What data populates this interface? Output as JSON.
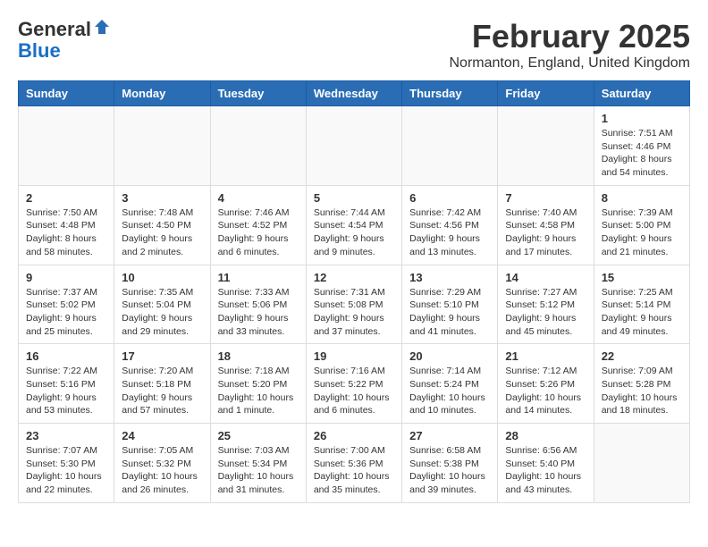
{
  "header": {
    "logo_line1": "General",
    "logo_line2": "Blue",
    "month_title": "February 2025",
    "location": "Normanton, England, United Kingdom"
  },
  "weekdays": [
    "Sunday",
    "Monday",
    "Tuesday",
    "Wednesday",
    "Thursday",
    "Friday",
    "Saturday"
  ],
  "weeks": [
    [
      {
        "day": "",
        "info": ""
      },
      {
        "day": "",
        "info": ""
      },
      {
        "day": "",
        "info": ""
      },
      {
        "day": "",
        "info": ""
      },
      {
        "day": "",
        "info": ""
      },
      {
        "day": "",
        "info": ""
      },
      {
        "day": "1",
        "info": "Sunrise: 7:51 AM\nSunset: 4:46 PM\nDaylight: 8 hours and 54 minutes."
      }
    ],
    [
      {
        "day": "2",
        "info": "Sunrise: 7:50 AM\nSunset: 4:48 PM\nDaylight: 8 hours and 58 minutes."
      },
      {
        "day": "3",
        "info": "Sunrise: 7:48 AM\nSunset: 4:50 PM\nDaylight: 9 hours and 2 minutes."
      },
      {
        "day": "4",
        "info": "Sunrise: 7:46 AM\nSunset: 4:52 PM\nDaylight: 9 hours and 6 minutes."
      },
      {
        "day": "5",
        "info": "Sunrise: 7:44 AM\nSunset: 4:54 PM\nDaylight: 9 hours and 9 minutes."
      },
      {
        "day": "6",
        "info": "Sunrise: 7:42 AM\nSunset: 4:56 PM\nDaylight: 9 hours and 13 minutes."
      },
      {
        "day": "7",
        "info": "Sunrise: 7:40 AM\nSunset: 4:58 PM\nDaylight: 9 hours and 17 minutes."
      },
      {
        "day": "8",
        "info": "Sunrise: 7:39 AM\nSunset: 5:00 PM\nDaylight: 9 hours and 21 minutes."
      }
    ],
    [
      {
        "day": "9",
        "info": "Sunrise: 7:37 AM\nSunset: 5:02 PM\nDaylight: 9 hours and 25 minutes."
      },
      {
        "day": "10",
        "info": "Sunrise: 7:35 AM\nSunset: 5:04 PM\nDaylight: 9 hours and 29 minutes."
      },
      {
        "day": "11",
        "info": "Sunrise: 7:33 AM\nSunset: 5:06 PM\nDaylight: 9 hours and 33 minutes."
      },
      {
        "day": "12",
        "info": "Sunrise: 7:31 AM\nSunset: 5:08 PM\nDaylight: 9 hours and 37 minutes."
      },
      {
        "day": "13",
        "info": "Sunrise: 7:29 AM\nSunset: 5:10 PM\nDaylight: 9 hours and 41 minutes."
      },
      {
        "day": "14",
        "info": "Sunrise: 7:27 AM\nSunset: 5:12 PM\nDaylight: 9 hours and 45 minutes."
      },
      {
        "day": "15",
        "info": "Sunrise: 7:25 AM\nSunset: 5:14 PM\nDaylight: 9 hours and 49 minutes."
      }
    ],
    [
      {
        "day": "16",
        "info": "Sunrise: 7:22 AM\nSunset: 5:16 PM\nDaylight: 9 hours and 53 minutes."
      },
      {
        "day": "17",
        "info": "Sunrise: 7:20 AM\nSunset: 5:18 PM\nDaylight: 9 hours and 57 minutes."
      },
      {
        "day": "18",
        "info": "Sunrise: 7:18 AM\nSunset: 5:20 PM\nDaylight: 10 hours and 1 minute."
      },
      {
        "day": "19",
        "info": "Sunrise: 7:16 AM\nSunset: 5:22 PM\nDaylight: 10 hours and 6 minutes."
      },
      {
        "day": "20",
        "info": "Sunrise: 7:14 AM\nSunset: 5:24 PM\nDaylight: 10 hours and 10 minutes."
      },
      {
        "day": "21",
        "info": "Sunrise: 7:12 AM\nSunset: 5:26 PM\nDaylight: 10 hours and 14 minutes."
      },
      {
        "day": "22",
        "info": "Sunrise: 7:09 AM\nSunset: 5:28 PM\nDaylight: 10 hours and 18 minutes."
      }
    ],
    [
      {
        "day": "23",
        "info": "Sunrise: 7:07 AM\nSunset: 5:30 PM\nDaylight: 10 hours and 22 minutes."
      },
      {
        "day": "24",
        "info": "Sunrise: 7:05 AM\nSunset: 5:32 PM\nDaylight: 10 hours and 26 minutes."
      },
      {
        "day": "25",
        "info": "Sunrise: 7:03 AM\nSunset: 5:34 PM\nDaylight: 10 hours and 31 minutes."
      },
      {
        "day": "26",
        "info": "Sunrise: 7:00 AM\nSunset: 5:36 PM\nDaylight: 10 hours and 35 minutes."
      },
      {
        "day": "27",
        "info": "Sunrise: 6:58 AM\nSunset: 5:38 PM\nDaylight: 10 hours and 39 minutes."
      },
      {
        "day": "28",
        "info": "Sunrise: 6:56 AM\nSunset: 5:40 PM\nDaylight: 10 hours and 43 minutes."
      },
      {
        "day": "",
        "info": ""
      }
    ]
  ]
}
